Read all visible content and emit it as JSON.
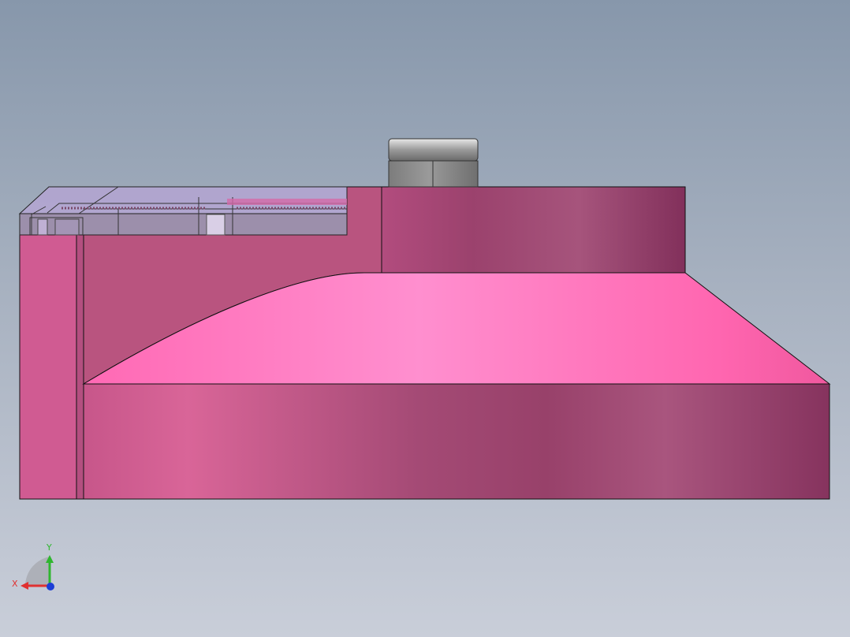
{
  "viewport": {
    "background_top": "#8797ab",
    "background_bottom": "#c9ced9"
  },
  "model": {
    "body_color": "#d45c93",
    "top_face_color": "#ff86c8",
    "glass_color": "#b4a8d8",
    "nut_color": "#8a8a8a"
  },
  "triad": {
    "x_label": "X",
    "y_label": "Y",
    "x_color": "#e03131",
    "y_color": "#2fb62f",
    "z_color": "#1c3ed6"
  }
}
